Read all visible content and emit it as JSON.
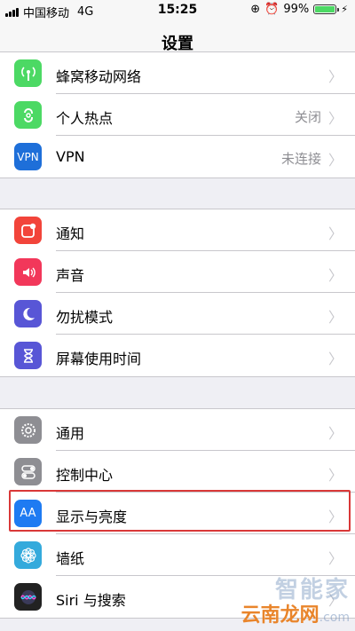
{
  "status_bar": {
    "carrier": "中国移动",
    "network": "4G",
    "time": "15:25",
    "battery": "99%",
    "battery_level": 0.99
  },
  "nav": {
    "title": "设置"
  },
  "groups": [
    {
      "items": [
        {
          "label": "蜂窝移动网络",
          "value": "",
          "icon": "antenna-icon",
          "color": "#4cd964"
        },
        {
          "label": "个人热点",
          "value": "关闭",
          "icon": "hotspot-icon",
          "color": "#4cd964"
        },
        {
          "label": "VPN",
          "value": "未连接",
          "icon": "vpn-icon",
          "icon_text": "VPN",
          "color": "#1e6fd9"
        }
      ]
    },
    {
      "items": [
        {
          "label": "通知",
          "icon": "notifications-icon",
          "color": "#f2443a"
        },
        {
          "label": "声音",
          "icon": "speaker-icon",
          "color": "#f2375a"
        },
        {
          "label": "勿扰模式",
          "icon": "moon-icon",
          "color": "#5856d6"
        },
        {
          "label": "屏幕使用时间",
          "icon": "hourglass-icon",
          "color": "#5856d6"
        }
      ]
    },
    {
      "items": [
        {
          "label": "通用",
          "icon": "gear-icon",
          "color": "#8e8e93"
        },
        {
          "label": "控制中心",
          "icon": "toggles-icon",
          "color": "#8e8e93"
        },
        {
          "label": "显示与亮度",
          "icon": "text-size-icon",
          "icon_text": "AA",
          "color": "#1e7bf2"
        },
        {
          "label": "墙纸",
          "icon": "flower-icon",
          "color": "#34aadc"
        },
        {
          "label": "Siri 与搜索",
          "icon": "siri-icon",
          "color": "#222222"
        }
      ]
    }
  ],
  "watermark": {
    "line1": "智能家",
    "line2": "云南龙网",
    "line3": ".com"
  }
}
